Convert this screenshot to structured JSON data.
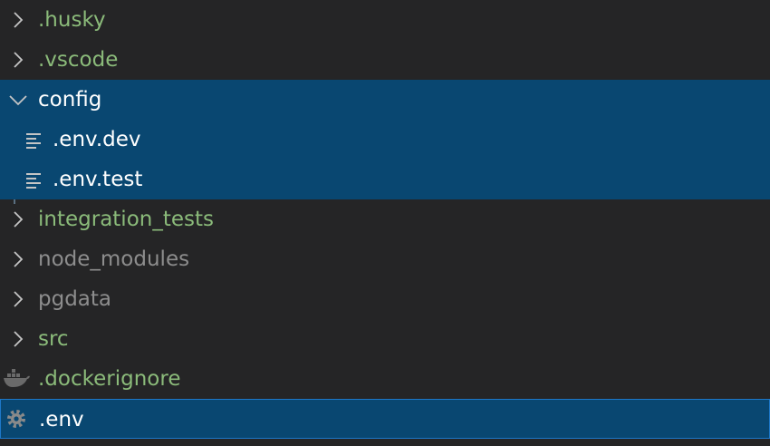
{
  "explorer": {
    "items": [
      {
        "label": ".husky",
        "type": "folder",
        "expanded": false,
        "color": "#8bbb7a",
        "icon": "chevron-right-icon"
      },
      {
        "label": ".vscode",
        "type": "folder",
        "expanded": false,
        "color": "#8bbb7a",
        "icon": "chevron-right-icon"
      },
      {
        "label": "config",
        "type": "folder",
        "expanded": true,
        "selected": true,
        "color": "#ffffff",
        "icon": "chevron-down-icon"
      },
      {
        "label": ".env.dev",
        "type": "file",
        "selected": true,
        "color": "#ffffff",
        "icon": "file-lines-icon"
      },
      {
        "label": ".env.test",
        "type": "file",
        "selected": true,
        "color": "#ffffff",
        "icon": "file-lines-icon"
      },
      {
        "label": "integration_tests",
        "type": "folder",
        "expanded": false,
        "color": "#8bbb7a",
        "icon": "chevron-right-icon"
      },
      {
        "label": "node_modules",
        "type": "folder",
        "expanded": false,
        "color": "#8d8d8d",
        "icon": "chevron-right-icon"
      },
      {
        "label": "pgdata",
        "type": "folder",
        "expanded": false,
        "color": "#8d8d8d",
        "icon": "chevron-right-icon"
      },
      {
        "label": "src",
        "type": "folder",
        "expanded": false,
        "color": "#8bbb7a",
        "icon": "chevron-right-icon"
      },
      {
        "label": ".dockerignore",
        "type": "file",
        "color": "#8bbb7a",
        "icon": "docker-icon"
      },
      {
        "label": ".env",
        "type": "file",
        "selected": true,
        "focused": true,
        "color": "#ffffff",
        "icon": "gear-icon"
      }
    ]
  },
  "colors": {
    "background": "#252526",
    "selection": "#094771",
    "focus_border": "#1d78c9",
    "git_modified": "#8bbb7a",
    "git_ignored": "#8d8d8d",
    "chevron": "#c5c5c5"
  }
}
